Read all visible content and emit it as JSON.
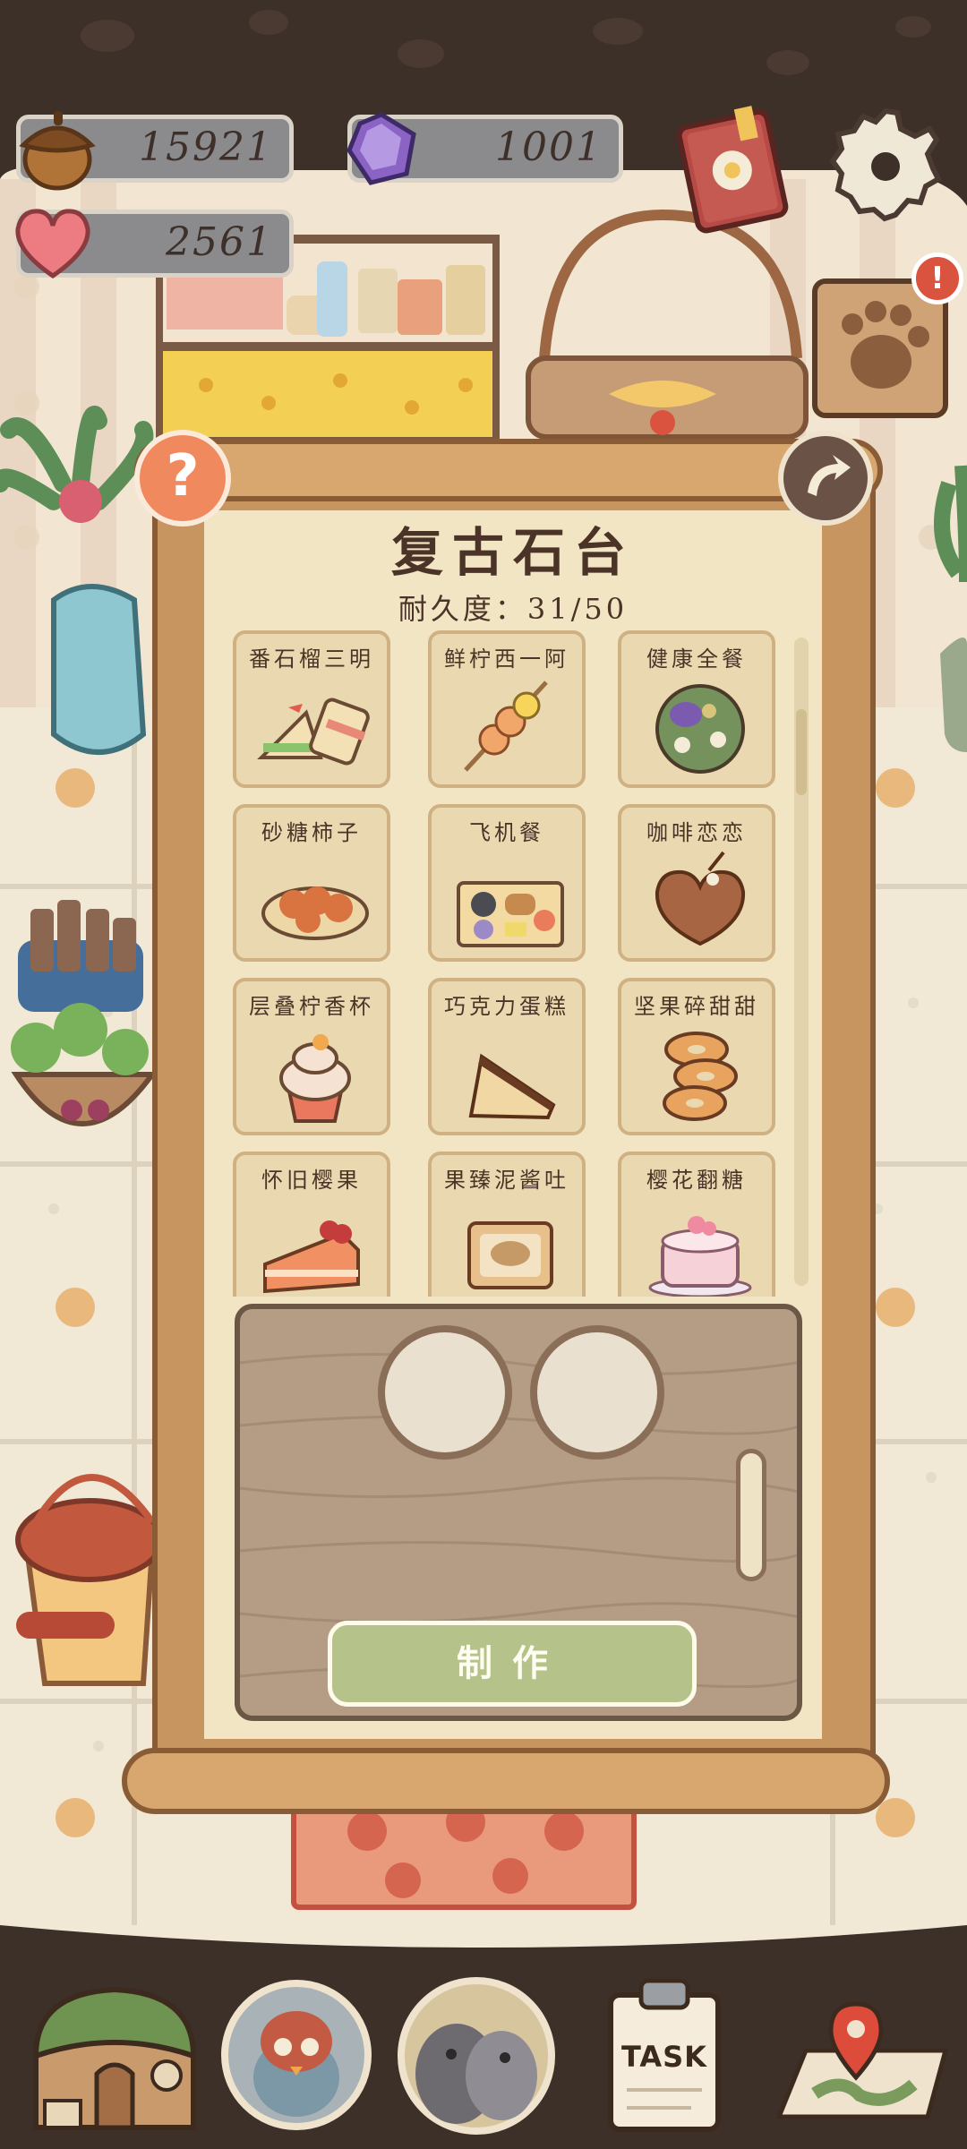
{
  "currency": {
    "acorn": {
      "icon": "acorn-icon",
      "value": "15921"
    },
    "gem": {
      "icon": "purple-gem-icon",
      "value": "1001"
    },
    "heart": {
      "icon": "heart-icon",
      "value": "2561"
    }
  },
  "top_right": {
    "book_icon": "recipe-book-icon",
    "settings_icon": "gear-icon",
    "notice_icon": "paw-note-icon",
    "alert": "!"
  },
  "panel": {
    "title": "复古石台",
    "durability": "耐久度：31/50",
    "help_label": "?",
    "recipes": [
      {
        "name": "番石榴三明",
        "icon": "sandwich-icon"
      },
      {
        "name": "鲜柠西一阿",
        "icon": "shrimp-skewer-icon"
      },
      {
        "name": "健康全餐",
        "icon": "healthy-bowl-icon"
      },
      {
        "name": "砂糖柿子",
        "icon": "persimmon-plate-icon"
      },
      {
        "name": "飞机餐",
        "icon": "meal-tray-icon"
      },
      {
        "name": "咖啡恋恋",
        "icon": "heart-cake-icon"
      },
      {
        "name": "层叠柠香杯",
        "icon": "cupcake-icon"
      },
      {
        "name": "巧克力蛋糕",
        "icon": "chocolate-cake-icon"
      },
      {
        "name": "坚果碎甜甜",
        "icon": "donut-stack-icon"
      },
      {
        "name": "怀旧樱果",
        "icon": "cherry-cake-slice-icon"
      },
      {
        "name": "果臻泥酱吐",
        "icon": "toast-icon"
      },
      {
        "name": "樱花翻糖",
        "icon": "sakura-cake-icon"
      }
    ],
    "craft_button": "制作"
  },
  "bottom_nav": [
    {
      "icon": "house-icon"
    },
    {
      "icon": "penguin-avatar-icon"
    },
    {
      "icon": "birds-icon"
    },
    {
      "icon": "task-clipboard-icon",
      "label": "TASK"
    },
    {
      "icon": "map-pin-icon"
    }
  ],
  "colors": {
    "panel_bg": "#f1e5c3",
    "frame": "#c69560",
    "button": "#b5c28a",
    "help": "#f0895d"
  }
}
